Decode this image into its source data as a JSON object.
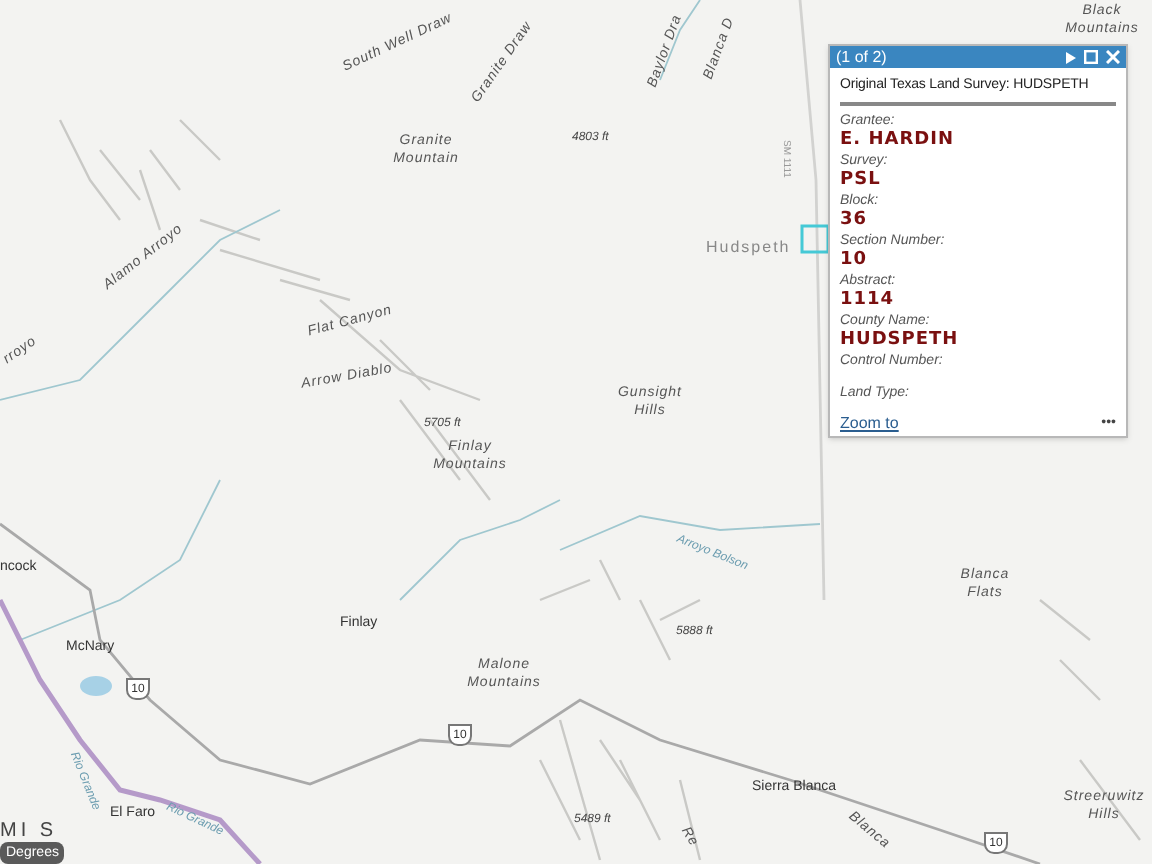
{
  "map_labels": [
    {
      "text": "South Well Draw",
      "kind": "water"
    },
    {
      "text": "Granite Draw",
      "kind": "water"
    },
    {
      "text": "Baylor Dra",
      "kind": "water"
    },
    {
      "text": "Blanca D",
      "kind": "water"
    },
    {
      "text": "Black Mountains",
      "kind": "terrain"
    },
    {
      "text": "Granite Mountain",
      "kind": "terrain"
    },
    {
      "text": "4803 ft",
      "kind": "elevation"
    },
    {
      "text": "SM 1111",
      "kind": "road"
    },
    {
      "text": "Hudspeth",
      "kind": "county"
    },
    {
      "text": "Alamo Arroyo",
      "kind": "water"
    },
    {
      "text": "rroyo",
      "kind": "water"
    },
    {
      "text": "Flat Canyon",
      "kind": "terrain"
    },
    {
      "text": "Arrow Diablo",
      "kind": "terrain"
    },
    {
      "text": "5705 ft",
      "kind": "elevation"
    },
    {
      "text": "Finlay Mountains",
      "kind": "terrain"
    },
    {
      "text": "Gunsight Hills",
      "kind": "terrain"
    },
    {
      "text": "Arroyo Bolson",
      "kind": "river"
    },
    {
      "text": "Blanca Flats",
      "kind": "terrain"
    },
    {
      "text": "ncock",
      "kind": "place"
    },
    {
      "text": "McNary",
      "kind": "place"
    },
    {
      "text": "Finlay",
      "kind": "place"
    },
    {
      "text": "Malone Mountains",
      "kind": "terrain"
    },
    {
      "text": "5888 ft",
      "kind": "elevation"
    },
    {
      "text": "Sierra Blanca",
      "kind": "place"
    },
    {
      "text": "El Faro",
      "kind": "place"
    },
    {
      "text": "Streeruwitz Hills",
      "kind": "terrain"
    },
    {
      "text": "Rio Grande",
      "kind": "river"
    },
    {
      "text": "Rio Grande",
      "kind": "river"
    },
    {
      "text": "5489 ft",
      "kind": "elevation"
    },
    {
      "text": "Blanca",
      "kind": "terrain"
    },
    {
      "text": "Re",
      "kind": "terrain"
    },
    {
      "text": "MI S",
      "kind": "scale"
    }
  ],
  "highway_shields": [
    "10",
    "10",
    "10"
  ],
  "basemap_button": {
    "label": "Degrees"
  },
  "popup": {
    "pager": "(1 of 2)",
    "title": "Original Texas Land Survey: HUDSPETH",
    "fields": [
      {
        "label": "Grantee:",
        "value": "E. HARDIN"
      },
      {
        "label": "Survey:",
        "value": "PSL"
      },
      {
        "label": "Block:",
        "value": "36"
      },
      {
        "label": "Section Number:",
        "value": "10"
      },
      {
        "label": "Abstract:",
        "value": "1114"
      },
      {
        "label": "County Name:",
        "value": "HUDSPETH"
      },
      {
        "label": "Control Number:"
      },
      {
        "label": "Land Type:"
      }
    ],
    "zoom_link": "Zoom to",
    "more": "•••"
  }
}
